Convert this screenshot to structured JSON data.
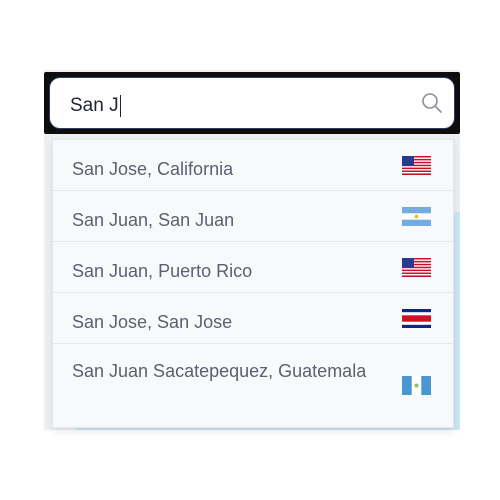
{
  "search": {
    "value": "San J",
    "icon": "search-icon"
  },
  "results": [
    {
      "label": "San Jose, California",
      "flag": "us-flag-icon"
    },
    {
      "label": "San Juan, San Juan",
      "flag": "argentina-flag-icon"
    },
    {
      "label": "San Juan, Puerto Rico",
      "flag": "us-flag-icon"
    },
    {
      "label": "San Jose, San Jose",
      "flag": "costa-rica-flag-icon"
    },
    {
      "label": "San Juan Sacatepequez, Guatemala",
      "flag": "guatemala-flag-icon"
    }
  ],
  "colors": {
    "search_border": "#2d3b66",
    "text": "#5a6170",
    "background_accent": "#cbe6f5"
  }
}
